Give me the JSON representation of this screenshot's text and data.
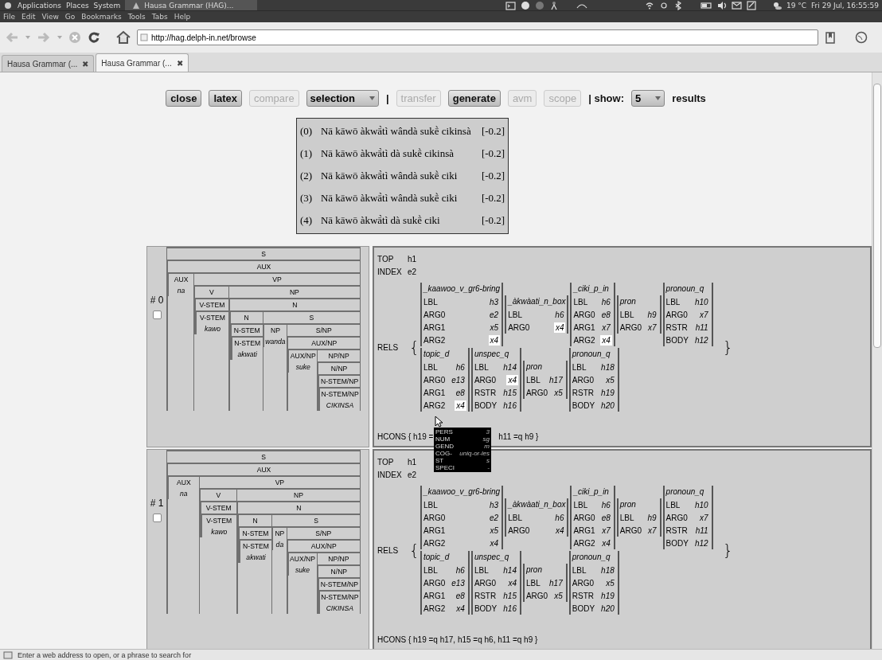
{
  "panel": {
    "menus": [
      "Applications",
      "Places",
      "System"
    ],
    "task": "Hausa Grammar (HAG)...",
    "weather": "19 °C",
    "clock": "Fri 29 Jul, 16:55:59"
  },
  "menubar": [
    "File",
    "Edit",
    "View",
    "Go",
    "Bookmarks",
    "Tools",
    "Tabs",
    "Help"
  ],
  "address": "http://hag.delph-in.net/browse",
  "tabs": [
    {
      "label": "Hausa Grammar (...",
      "close": "✖",
      "selected": false
    },
    {
      "label": "Hausa Grammar (...",
      "close": "✖",
      "selected": true
    }
  ],
  "controls": [
    {
      "kind": "button",
      "label": "close",
      "disabled": false
    },
    {
      "kind": "button",
      "label": "latex",
      "disabled": false
    },
    {
      "kind": "button",
      "label": "compare",
      "disabled": true
    },
    {
      "kind": "select",
      "label": "selection",
      "disabled": false
    },
    {
      "kind": "text",
      "label": "|"
    },
    {
      "kind": "button",
      "label": "transfer",
      "disabled": true
    },
    {
      "kind": "button",
      "label": "generate",
      "disabled": false
    },
    {
      "kind": "button",
      "label": "avm",
      "disabled": true
    },
    {
      "kind": "button",
      "label": "scope",
      "disabled": true
    },
    {
      "kind": "text",
      "label": "| show:"
    },
    {
      "kind": "select",
      "label": "5",
      "disabled": false
    },
    {
      "kind": "text",
      "label": "results"
    }
  ],
  "results_list": [
    {
      "index": "(0)",
      "text": "Nā kāwō àkwā̀tì wândà sukḕ cikinsà",
      "score": "[-0.2]"
    },
    {
      "index": "(1)",
      "text": "Nā kāwō àkwā̀tì dà sukḕ cikinsà",
      "score": "[-0.2]"
    },
    {
      "index": "(2)",
      "text": "Nā kāwō àkwā̀tì wândà sukḕ ciki",
      "score": "[-0.2]"
    },
    {
      "index": "(3)",
      "text": "Nā kāwō àkwā̀tì wândà sukḕ ciki",
      "score": "[-0.2]"
    },
    {
      "index": "(4)",
      "text": "Nā kāwō àkwā̀tì dà sukḕ ciki",
      "score": "[-0.2]"
    }
  ],
  "analyses": [
    {
      "number": "# 0",
      "checked": false,
      "tree": {
        "label": "S",
        "children": [
          {
            "label": "AUX",
            "children": [
              {
                "label": "AUX",
                "word": "na"
              },
              {
                "label": "VP",
                "children": [
                  {
                    "label": "V",
                    "children": [
                      {
                        "label": "V-STEM",
                        "children": [
                          {
                            "label": "V-STEM",
                            "word": "kawo"
                          }
                        ]
                      }
                    ]
                  },
                  {
                    "label": "NP",
                    "children": [
                      {
                        "label": "N",
                        "children": [
                          {
                            "label": "N",
                            "children": [
                              {
                                "label": "N-STEM",
                                "children": [
                                  {
                                    "label": "N-STEM",
                                    "word": "akwati"
                                  }
                                ]
                              }
                            ]
                          },
                          {
                            "label": "S",
                            "children": [
                              {
                                "label": "NP",
                                "word": "wanda"
                              },
                              {
                                "label": "S/NP",
                                "children": [
                                  {
                                    "label": "AUX/NP",
                                    "children": [
                                      {
                                        "label": "AUX/NP",
                                        "word": "suke"
                                      },
                                      {
                                        "label": "NP/NP",
                                        "children": [
                                          {
                                            "label": "N/NP",
                                            "children": [
                                              {
                                                "label": "N-STEM/NP",
                                                "children": [
                                                  {
                                                    "label": "N-STEM/NP",
                                                    "word": "CIKINSA"
                                                  }
                                                ]
                                              }
                                            ]
                                          }
                                        ]
                                      }
                                    ]
                                  }
                                ]
                              }
                            ]
                          }
                        ]
                      }
                    ]
                  }
                ]
              }
            ]
          }
        ]
      },
      "mrs": {
        "top": [
          "TOP",
          "h1"
        ],
        "index": [
          "INDEX",
          "e2"
        ],
        "rels_label": "RELS",
        "open": "{",
        "close": "}",
        "rels": [
          [
            {
              "pred": "_kaawoo_v_gr6-bring",
              "roles": [
                {
                  "feature": "LBL",
                  "value": "h3",
                  "highlighted": false
                },
                {
                  "feature": "ARG0",
                  "value": "e2",
                  "highlighted": false
                },
                {
                  "feature": "ARG1",
                  "value": "x5",
                  "highlighted": false
                },
                {
                  "feature": "ARG2",
                  "value": "x4",
                  "highlighted": true
                }
              ]
            },
            {
              "pred": "_àkwàati_n_box",
              "roles": [
                {
                  "feature": "LBL",
                  "value": "h6",
                  "highlighted": false
                },
                {
                  "feature": "ARG0",
                  "value": "x4",
                  "highlighted": true
                }
              ]
            },
            {
              "pred": "_ciki_p_in",
              "roles": [
                {
                  "feature": "LBL",
                  "value": "h6",
                  "highlighted": false
                },
                {
                  "feature": "ARG0",
                  "value": "e8",
                  "highlighted": false
                },
                {
                  "feature": "ARG1",
                  "value": "x7",
                  "highlighted": false
                },
                {
                  "feature": "ARG2",
                  "value": "x4",
                  "highlighted": true
                }
              ]
            },
            {
              "pred": "pron",
              "roles": [
                {
                  "feature": "LBL",
                  "value": "h9",
                  "highlighted": false
                },
                {
                  "feature": "ARG0",
                  "value": "x7",
                  "highlighted": false
                }
              ]
            },
            {
              "pred": "pronoun_q",
              "roles": [
                {
                  "feature": "LBL",
                  "value": "h10",
                  "highlighted": false
                },
                {
                  "feature": "ARG0",
                  "value": "x7",
                  "highlighted": false
                },
                {
                  "feature": "RSTR",
                  "value": "h11",
                  "highlighted": false
                },
                {
                  "feature": "BODY",
                  "value": "h12",
                  "highlighted": false
                }
              ]
            }
          ],
          [
            {
              "pred": "topic_d",
              "roles": [
                {
                  "feature": "LBL",
                  "value": "h6",
                  "highlighted": false
                },
                {
                  "feature": "ARG0",
                  "value": "e13",
                  "highlighted": false
                },
                {
                  "feature": "ARG1",
                  "value": "e8",
                  "highlighted": false
                },
                {
                  "feature": "ARG2",
                  "value": "x4",
                  "highlighted": true
                }
              ]
            },
            {
              "pred": "unspec_q",
              "roles": [
                {
                  "feature": "LBL",
                  "value": "h14",
                  "highlighted": false
                },
                {
                  "feature": "ARG0",
                  "value": "x4",
                  "highlighted": true
                },
                {
                  "feature": "RSTR",
                  "value": "h15",
                  "highlighted": false
                },
                {
                  "feature": "BODY",
                  "value": "h16",
                  "highlighted": false
                }
              ]
            },
            {
              "pred": "pron",
              "roles": [
                {
                  "feature": "LBL",
                  "value": "h17",
                  "highlighted": false
                },
                {
                  "feature": "ARG0",
                  "value": "x5",
                  "highlighted": false
                }
              ]
            },
            {
              "pred": "pronoun_q",
              "roles": [
                {
                  "feature": "LBL",
                  "value": "h18",
                  "highlighted": false
                },
                {
                  "feature": "ARG0",
                  "value": "x5",
                  "highlighted": false
                },
                {
                  "feature": "RSTR",
                  "value": "h19",
                  "highlighted": false
                },
                {
                  "feature": "BODY",
                  "value": "h20",
                  "highlighted": false
                }
              ]
            }
          ]
        ],
        "hcons": [
          "HCONS { h19 =",
          "h11 =q h9 }"
        ]
      }
    },
    {
      "number": "# 1",
      "checked": false,
      "tree": {
        "label": "S",
        "children": [
          {
            "label": "AUX",
            "children": [
              {
                "label": "AUX",
                "word": "na"
              },
              {
                "label": "VP",
                "children": [
                  {
                    "label": "V",
                    "children": [
                      {
                        "label": "V-STEM",
                        "children": [
                          {
                            "label": "V-STEM",
                            "word": "kawo"
                          }
                        ]
                      }
                    ]
                  },
                  {
                    "label": "NP",
                    "children": [
                      {
                        "label": "N",
                        "children": [
                          {
                            "label": "N",
                            "children": [
                              {
                                "label": "N-STEM",
                                "children": [
                                  {
                                    "label": "N-STEM",
                                    "word": "akwati"
                                  }
                                ]
                              }
                            ]
                          },
                          {
                            "label": "S",
                            "children": [
                              {
                                "label": "NP",
                                "word": "da"
                              },
                              {
                                "label": "S/NP",
                                "children": [
                                  {
                                    "label": "AUX/NP",
                                    "children": [
                                      {
                                        "label": "AUX/NP",
                                        "word": "suke"
                                      },
                                      {
                                        "label": "NP/NP",
                                        "children": [
                                          {
                                            "label": "N/NP",
                                            "children": [
                                              {
                                                "label": "N-STEM/NP",
                                                "children": [
                                                  {
                                                    "label": "N-STEM/NP",
                                                    "word": "CIKINSA"
                                                  }
                                                ]
                                              }
                                            ]
                                          }
                                        ]
                                      }
                                    ]
                                  }
                                ]
                              }
                            ]
                          }
                        ]
                      }
                    ]
                  }
                ]
              }
            ]
          }
        ]
      },
      "mrs": {
        "top": [
          "TOP",
          "h1"
        ],
        "index": [
          "INDEX",
          "e2"
        ],
        "rels_label": "RELS",
        "open": "{",
        "close": "}",
        "rels": [
          [
            {
              "pred": "_kaawoo_v_gr6-bring",
              "roles": [
                {
                  "feature": "LBL",
                  "value": "h3",
                  "highlighted": false
                },
                {
                  "feature": "ARG0",
                  "value": "e2",
                  "highlighted": false
                },
                {
                  "feature": "ARG1",
                  "value": "x5",
                  "highlighted": false
                },
                {
                  "feature": "ARG2",
                  "value": "x4",
                  "highlighted": false
                }
              ]
            },
            {
              "pred": "_àkwàati_n_box",
              "roles": [
                {
                  "feature": "LBL",
                  "value": "h6",
                  "highlighted": false
                },
                {
                  "feature": "ARG0",
                  "value": "x4",
                  "highlighted": false
                }
              ]
            },
            {
              "pred": "_ciki_p_in",
              "roles": [
                {
                  "feature": "LBL",
                  "value": "h6",
                  "highlighted": false
                },
                {
                  "feature": "ARG0",
                  "value": "e8",
                  "highlighted": false
                },
                {
                  "feature": "ARG1",
                  "value": "x7",
                  "highlighted": false
                },
                {
                  "feature": "ARG2",
                  "value": "x4",
                  "highlighted": false
                }
              ]
            },
            {
              "pred": "pron",
              "roles": [
                {
                  "feature": "LBL",
                  "value": "h9",
                  "highlighted": false
                },
                {
                  "feature": "ARG0",
                  "value": "x7",
                  "highlighted": false
                }
              ]
            },
            {
              "pred": "pronoun_q",
              "roles": [
                {
                  "feature": "LBL",
                  "value": "h10",
                  "highlighted": false
                },
                {
                  "feature": "ARG0",
                  "value": "x7",
                  "highlighted": false
                },
                {
                  "feature": "RSTR",
                  "value": "h11",
                  "highlighted": false
                },
                {
                  "feature": "BODY",
                  "value": "h12",
                  "highlighted": false
                }
              ]
            }
          ],
          [
            {
              "pred": "topic_d",
              "roles": [
                {
                  "feature": "LBL",
                  "value": "h6",
                  "highlighted": false
                },
                {
                  "feature": "ARG0",
                  "value": "e13",
                  "highlighted": false
                },
                {
                  "feature": "ARG1",
                  "value": "e8",
                  "highlighted": false
                },
                {
                  "feature": "ARG2",
                  "value": "x4",
                  "highlighted": false
                }
              ]
            },
            {
              "pred": "unspec_q",
              "roles": [
                {
                  "feature": "LBL",
                  "value": "h14",
                  "highlighted": false
                },
                {
                  "feature": "ARG0",
                  "value": "x4",
                  "highlighted": false
                },
                {
                  "feature": "RSTR",
                  "value": "h15",
                  "highlighted": false
                },
                {
                  "feature": "BODY",
                  "value": "h16",
                  "highlighted": false
                }
              ]
            },
            {
              "pred": "pron",
              "roles": [
                {
                  "feature": "LBL",
                  "value": "h17",
                  "highlighted": false
                },
                {
                  "feature": "ARG0",
                  "value": "x5",
                  "highlighted": false
                }
              ]
            },
            {
              "pred": "pronoun_q",
              "roles": [
                {
                  "feature": "LBL",
                  "value": "h18",
                  "highlighted": false
                },
                {
                  "feature": "ARG0",
                  "value": "x5",
                  "highlighted": false
                },
                {
                  "feature": "RSTR",
                  "value": "h19",
                  "highlighted": false
                },
                {
                  "feature": "BODY",
                  "value": "h20",
                  "highlighted": false
                }
              ]
            }
          ]
        ],
        "hcons": [
          "HCONS { h19 =q h17, h15 =q h6, h11 =q h9 }"
        ]
      }
    }
  ],
  "tooltip": [
    {
      "feature": "PERS",
      "value": "3"
    },
    {
      "feature": "NUM",
      "value": "sg"
    },
    {
      "feature": "GEND",
      "value": "m"
    },
    {
      "feature": "COG-ST",
      "value": "uniq-or-less"
    },
    {
      "feature": "SPECI",
      "value": "-"
    }
  ],
  "status": "Enter a web address to open, or a phrase to search for"
}
